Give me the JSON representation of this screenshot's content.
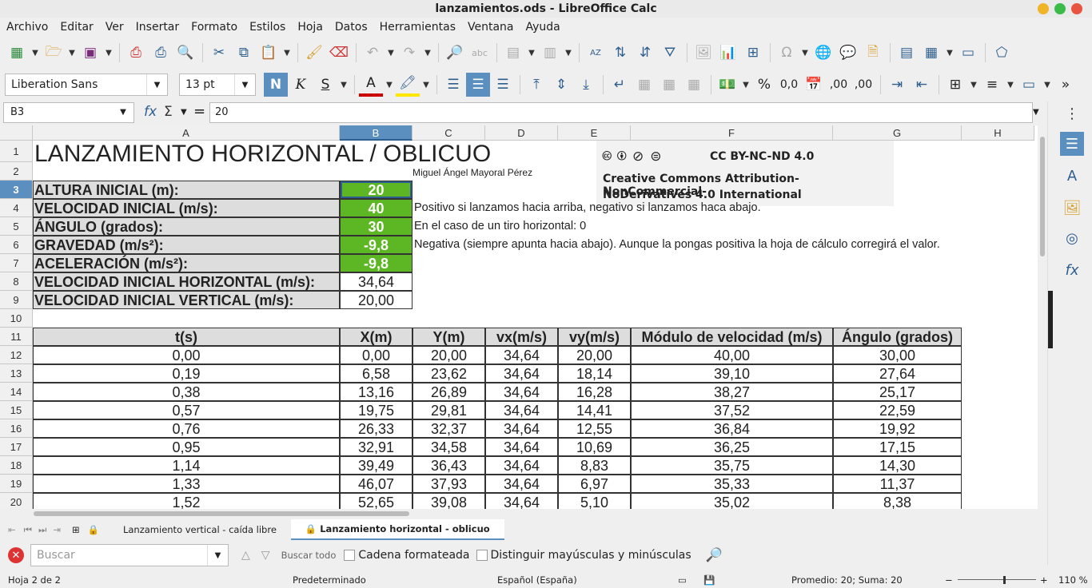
{
  "window": {
    "title": "lanzamientos.ods - LibreOffice Calc"
  },
  "menu": [
    "Archivo",
    "Editar",
    "Ver",
    "Insertar",
    "Formato",
    "Estilos",
    "Hoja",
    "Datos",
    "Herramientas",
    "Ventana",
    "Ayuda"
  ],
  "format": {
    "font_name": "Liberation Sans",
    "font_size": "13 pt",
    "bold_label": "N",
    "italic_label": "K",
    "underline_label": "S",
    "percent": "%",
    "decimal": "0,0",
    "add_dec": ",00",
    "del_dec": ",00"
  },
  "formula": {
    "cell_ref": "B3",
    "content": "20"
  },
  "columns": [
    {
      "name": "A",
      "w": 384
    },
    {
      "name": "B",
      "w": 91
    },
    {
      "name": "C",
      "w": 91
    },
    {
      "name": "D",
      "w": 91
    },
    {
      "name": "E",
      "w": 91
    },
    {
      "name": "F",
      "w": 253
    },
    {
      "name": "G",
      "w": 161
    },
    {
      "name": "H",
      "w": 91
    }
  ],
  "rows": [
    "1",
    "2",
    "3",
    "4",
    "5",
    "6",
    "7",
    "8",
    "9",
    "10",
    "11",
    "12",
    "13",
    "14",
    "15",
    "16",
    "17",
    "18",
    "19",
    "20"
  ],
  "selected": {
    "col": "B",
    "row": "3"
  },
  "sheet": {
    "title": "LANZAMIENTO HORIZONTAL / OBLICUO",
    "author": "Miguel Ángel Mayoral Pérez",
    "license": {
      "badge": "CC BY-NC-ND 4.0",
      "line1": "Creative Commons Attribution-NonCommercial-",
      "line2": "NoDerivatives 4.0 International"
    },
    "params": [
      {
        "label": "ALTURA INICIAL (m):",
        "value": "20",
        "input": true,
        "note": ""
      },
      {
        "label": "VELOCIDAD INICIAL (m/s):",
        "value": "40",
        "input": true,
        "note": "Positivo si lanzamos hacia arriba, negativo si lanzamos haca abajo."
      },
      {
        "label": "ÁNGULO (grados):",
        "value": "30",
        "input": true,
        "note": "En el caso de un tiro horizontal: 0"
      },
      {
        "label": "GRAVEDAD (m/s²):",
        "value": "-9,8",
        "input": true,
        "note": "Negativa (siempre apunta hacia abajo). Aunque la pongas positiva la hoja de cálculo corregirá el valor."
      },
      {
        "label": "ACELERACIÓN (m/s²):",
        "value": "-9,8",
        "input": true,
        "note": ""
      },
      {
        "label": "VELOCIDAD INICIAL HORIZONTAL (m/s):",
        "value": "34,64",
        "input": false,
        "note": ""
      },
      {
        "label": "VELOCIDAD INICIAL VERTICAL (m/s):",
        "value": "20,00",
        "input": false,
        "note": ""
      }
    ],
    "table_headers": [
      "t(s)",
      "X(m)",
      "Y(m)",
      "vx(m/s)",
      "vy(m/s)",
      "Módulo de velocidad (m/s)",
      "Ángulo (grados)"
    ],
    "table_rows": [
      [
        "0,00",
        "0,00",
        "20,00",
        "34,64",
        "20,00",
        "40,00",
        "30,00"
      ],
      [
        "0,19",
        "6,58",
        "23,62",
        "34,64",
        "18,14",
        "39,10",
        "27,64"
      ],
      [
        "0,38",
        "13,16",
        "26,89",
        "34,64",
        "16,28",
        "38,27",
        "25,17"
      ],
      [
        "0,57",
        "19,75",
        "29,81",
        "34,64",
        "14,41",
        "37,52",
        "22,59"
      ],
      [
        "0,76",
        "26,33",
        "32,37",
        "34,64",
        "12,55",
        "36,84",
        "19,92"
      ],
      [
        "0,95",
        "32,91",
        "34,58",
        "34,64",
        "10,69",
        "36,25",
        "17,15"
      ],
      [
        "1,14",
        "39,49",
        "36,43",
        "34,64",
        "8,83",
        "35,75",
        "14,30"
      ],
      [
        "1,33",
        "46,07",
        "37,93",
        "34,64",
        "6,97",
        "35,33",
        "11,37"
      ],
      [
        "1,52",
        "52,65",
        "39,08",
        "34,64",
        "5,10",
        "35,02",
        "8,38"
      ]
    ]
  },
  "tabs": [
    "Lanzamiento vertical - caída libre",
    "Lanzamiento horizontal - oblicuo"
  ],
  "find": {
    "placeholder": "Buscar",
    "find_all": "Buscar todo",
    "formatted": "Cadena formateada",
    "match_case": "Distinguir mayúsculas y minúsculas"
  },
  "status": {
    "sheet": "Hoja 2 de 2",
    "style": "Predeterminado",
    "language": "Español (España)",
    "summary": "Promedio: 20; Suma: 20",
    "zoom": "110 %"
  },
  "colors": {
    "selection": "#5a8fc0",
    "input_cell": "#5db624",
    "label_cell": "#dddddd"
  }
}
